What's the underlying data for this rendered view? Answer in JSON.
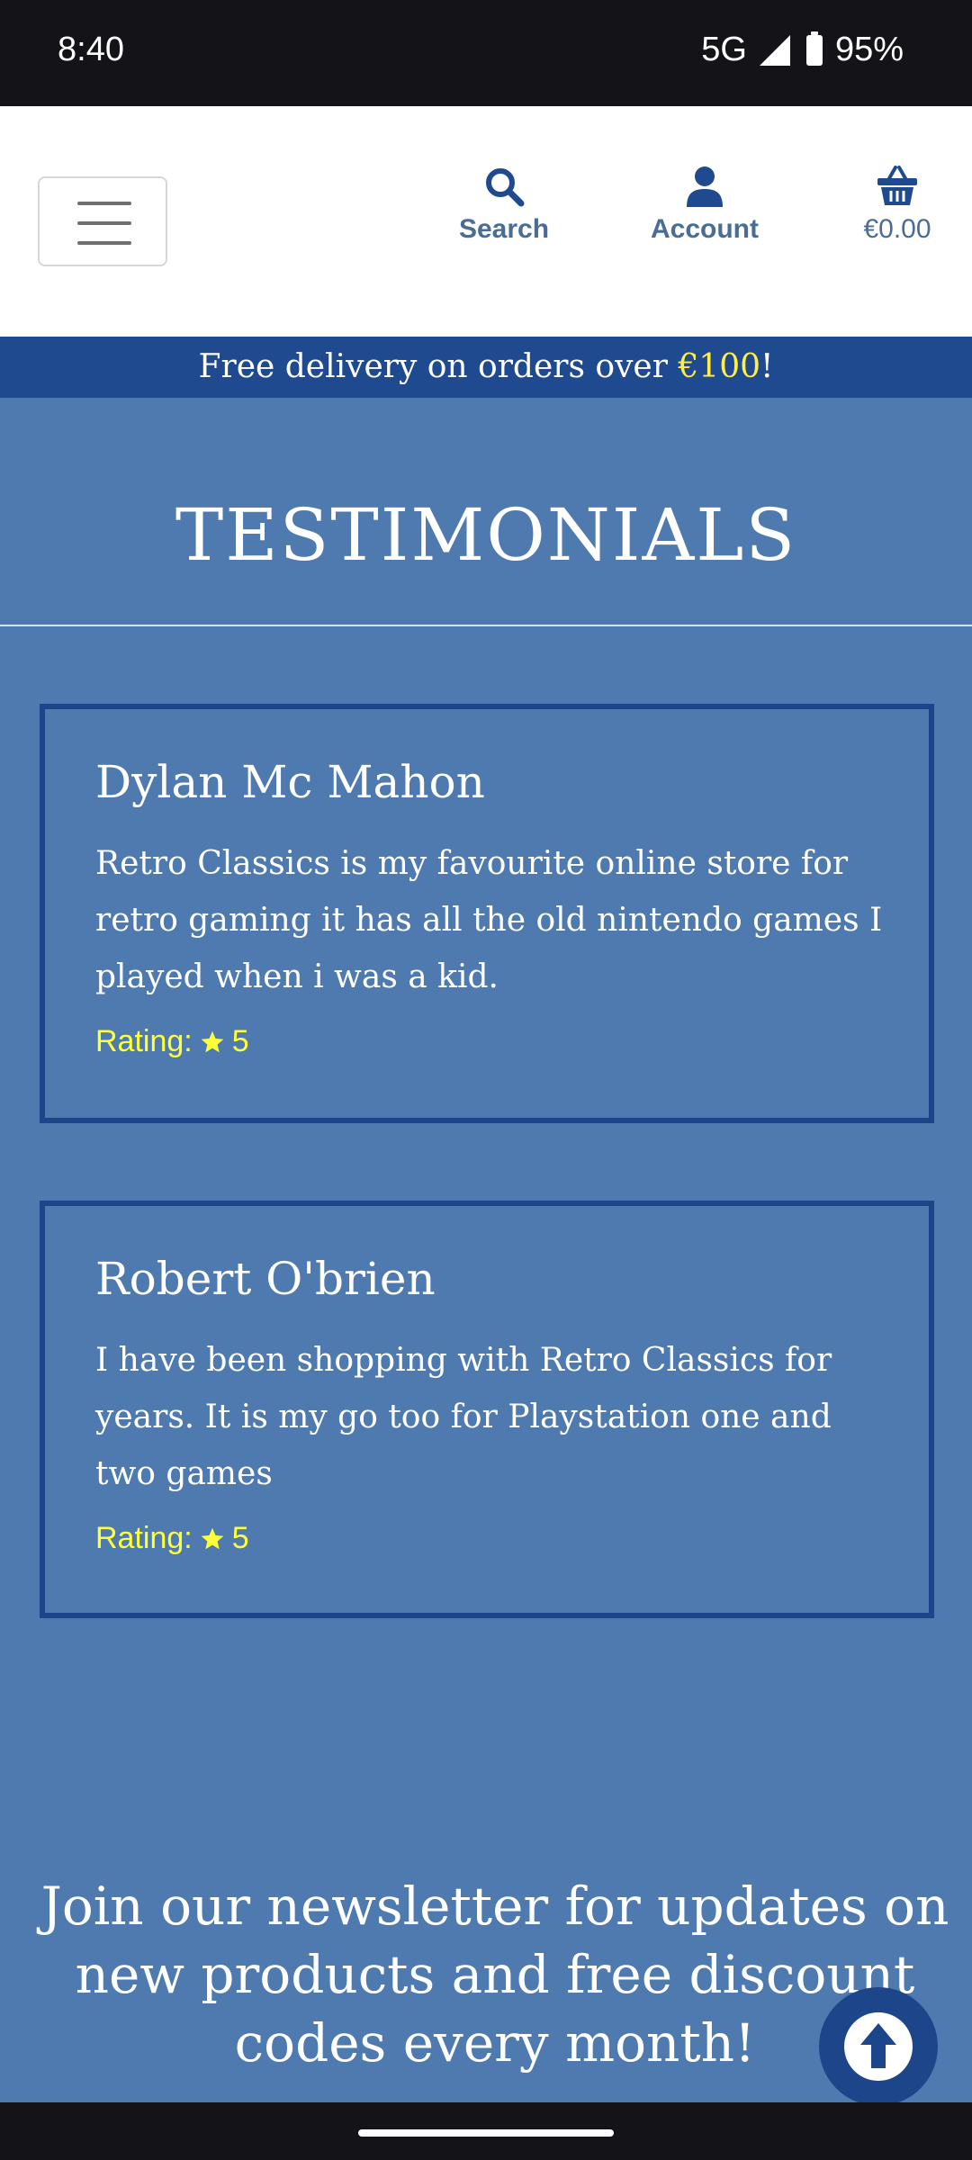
{
  "status_bar": {
    "time": "8:40",
    "network": "5G",
    "battery": "95%"
  },
  "header": {
    "menu_icon": "hamburger-icon",
    "search_label": "Search",
    "account_label": "Account",
    "cart_total": "€0.00"
  },
  "banner": {
    "text_before": "Free delivery on orders over ",
    "highlight": "€100",
    "text_after": "!"
  },
  "page": {
    "title": "TESTIMONIALS"
  },
  "testimonials": [
    {
      "name": "Dylan Mc Mahon",
      "text": "Retro Classics is my favourite online store for retro gaming it has all the old nintendo games I played when i was a kid.",
      "rating_label": "Rating:",
      "rating_value": "5"
    },
    {
      "name": "Robert O'brien",
      "text": "I have been shopping with Retro Classics for years. It is my go too for Playstation one and two games",
      "rating_label": "Rating:",
      "rating_value": "5"
    }
  ],
  "newsletter": {
    "heading": "Join our newsletter for updates on new products and free discount codes every month!"
  },
  "colors": {
    "page_bg": "#4e7aaf",
    "banner_bg": "#204a8f",
    "accent_yellow": "#ffee4a",
    "card_border": "#1d468a"
  }
}
